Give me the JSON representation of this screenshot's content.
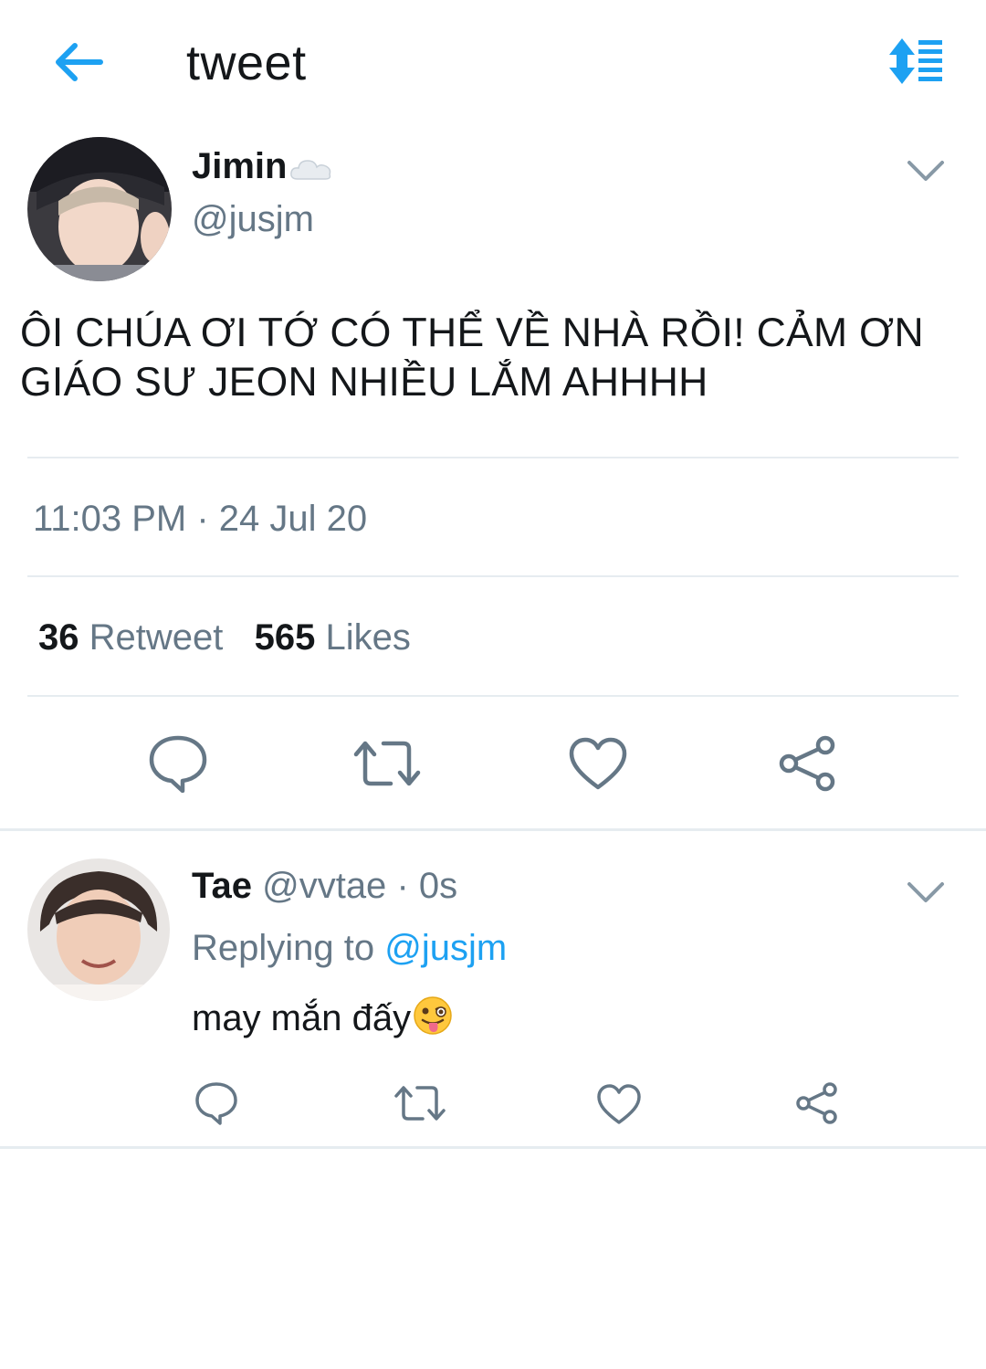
{
  "header": {
    "title": "tweet",
    "back_icon": "arrow-left-icon",
    "sort_icon": "sort-list-icon",
    "accent": "#1da1f2"
  },
  "tweet": {
    "author": {
      "name": "Jimin",
      "handle": "@jusjm",
      "name_icon": "cloud-icon"
    },
    "text": "ÔI CHÚA ƠI TỚ CÓ THỂ VỀ NHÀ RỒI! CẢM ƠN GIÁO SƯ JEON NHIỀU LẮM AHHHH",
    "timestamp": "11:03 PM · 24 Jul 20",
    "stats": {
      "retweets_count": "36",
      "retweets_label": "Retweet",
      "likes_count": "565",
      "likes_label": "Likes"
    },
    "actions": [
      "reply-icon",
      "retweet-icon",
      "like-icon",
      "share-icon"
    ]
  },
  "reply": {
    "author": {
      "name": "Tae",
      "handle": "@vvtae",
      "time": "· 0s"
    },
    "replying_label": "Replying to",
    "replying_to": "@jusjm",
    "text": "may mắn đấy",
    "emoji": "winking-tongue-emoji",
    "actions": [
      "reply-icon",
      "retweet-icon",
      "like-icon",
      "share-icon"
    ]
  },
  "colors": {
    "text": "#14171a",
    "secondary": "#657786",
    "icon": "#657786",
    "divider": "#e6ecf0",
    "link": "#1da1f2"
  }
}
